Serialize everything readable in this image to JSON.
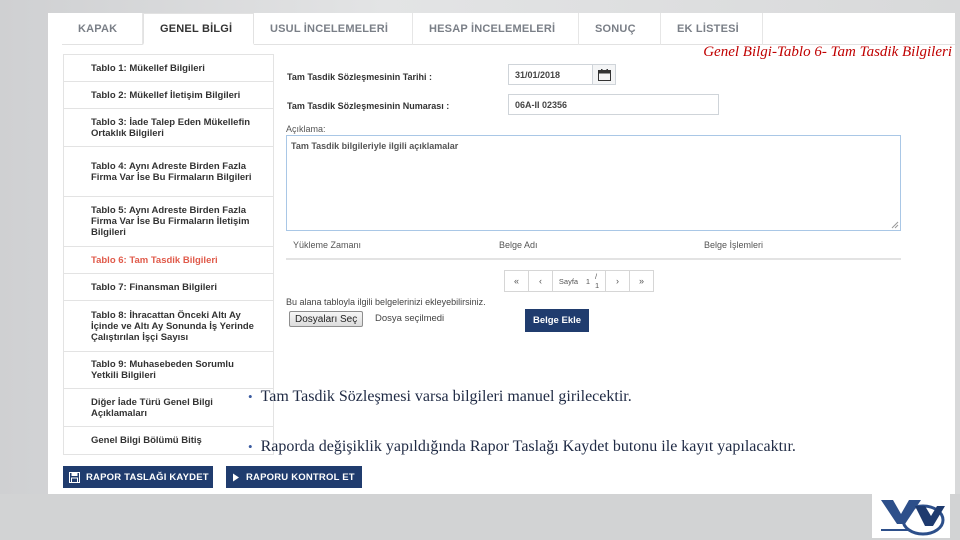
{
  "slide_title": "Genel Bilgi-Tablo 6- Tam Tasdik Bilgileri",
  "tabs": [
    {
      "label": "KAPAK"
    },
    {
      "label": "GENEL BİLGİ"
    },
    {
      "label": "USUL İNCELEMELERİ"
    },
    {
      "label": "HESAP İNCELEMELERİ"
    },
    {
      "label": "SONUÇ"
    },
    {
      "label": "EK LİSTESİ"
    }
  ],
  "menu": [
    {
      "label": "Tablo 1: Mükellef Bilgileri"
    },
    {
      "label": "Tablo 2: Mükellef İletişim Bilgileri"
    },
    {
      "label": "Tablo 3: İade Talep Eden Mükellefin Ortaklık Bilgileri"
    },
    {
      "label": "Tablo 4: Aynı Adreste Birden Fazla Firma Var İse Bu Firmaların Bilgileri"
    },
    {
      "label": "Tablo 5: Aynı Adreste Birden Fazla Firma Var İse Bu Firmaların İletişim Bilgileri"
    },
    {
      "label": "Tablo 6: Tam Tasdik Bilgileri"
    },
    {
      "label": "Tablo 7: Finansman Bilgileri"
    },
    {
      "label": "Tablo 8: İhracattan Önceki Altı Ay İçinde ve Altı Ay Sonunda İş Yerinde Çalıştırılan İşçi Sayısı"
    },
    {
      "label": "Tablo 9: Muhasebeden Sorumlu Yetkili Bilgileri"
    },
    {
      "label": "Diğer İade Türü Genel Bilgi Açıklamaları"
    },
    {
      "label": "Genel Bilgi Bölümü Bitiş"
    }
  ],
  "form": {
    "date_label": "Tam Tasdik Sözleşmesinin Tarihi :",
    "date_value": "31/01/2018",
    "number_label": "Tam Tasdik Sözleşmesinin Numarası :",
    "number_value": "06A-II 02356",
    "desc_label": "Açıklama:",
    "desc_value": "Tam Tasdik bilgileriyle ilgili açıklamalar"
  },
  "table": {
    "columns": [
      "Yükleme Zamanı",
      "Belge Adı",
      "Belge İşlemleri"
    ]
  },
  "pager": {
    "first": "«",
    "prev": "‹",
    "page_label": "Sayfa",
    "page_value": "1",
    "page_total": "/ 1",
    "next": "›",
    "last": "»"
  },
  "upload": {
    "hint": "Bu alana tabloyla ilgili belgelerinizi ekleyebilirsiniz.",
    "choose_button": "Dosyaları Seç",
    "no_file": "Dosya seçilmedi",
    "add_button": "Belge Ekle"
  },
  "bullets": [
    "Tam Tasdik Sözleşmesi varsa bilgileri manuel girilecektir.",
    "Raporda değişiklik yapıldığında Rapor Taslağı Kaydet butonu ile kayıt yapılacaktır."
  ],
  "bottom_buttons": {
    "save": "RAPOR TASLAĞI KAYDET",
    "check": "RAPORU KONTROL ET"
  },
  "colors": {
    "accent": "#203c6e",
    "active_menu": "#e05a4a",
    "title": "#c00000"
  }
}
